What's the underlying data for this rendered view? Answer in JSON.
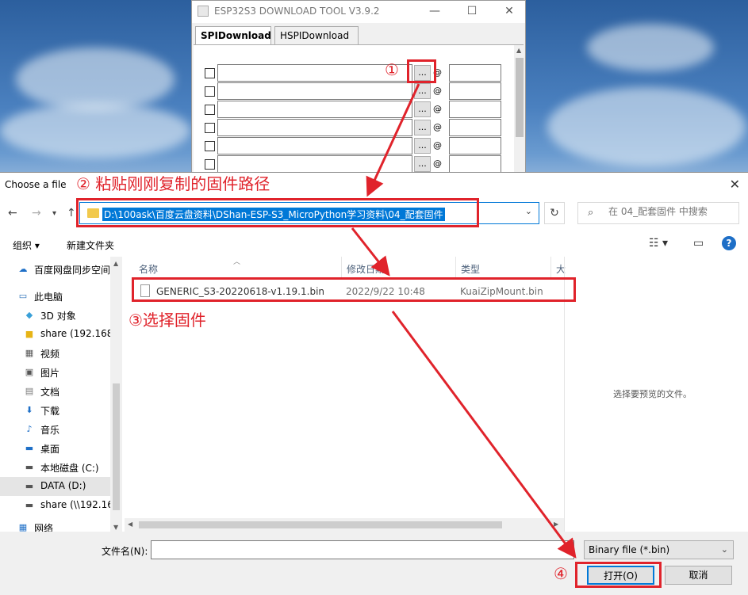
{
  "esp_tool": {
    "title": "ESP32S3 DOWNLOAD TOOL V3.9.2",
    "tabs": [
      "SPIDownload",
      "HSPIDownload"
    ],
    "browse_label": "...",
    "at_label": "@"
  },
  "dialog": {
    "title": "Choose a file",
    "address": "D:\\100ask\\百度云盘资料\\DShan-ESP-S3_MicroPython学习资料\\04_配套固件",
    "search_placeholder": "在 04_配套固件 中搜索",
    "toolbar": {
      "organize": "组织 ▾",
      "new_folder": "新建文件夹"
    },
    "sidebar": [
      {
        "label": "百度网盘同步空间",
        "icon": "cloud-icon"
      },
      {
        "label": "此电脑",
        "icon": "computer-icon"
      },
      {
        "label": "3D 对象",
        "icon": "cube-icon"
      },
      {
        "label": "share (192.168",
        "icon": "network-folder-icon"
      },
      {
        "label": "视频",
        "icon": "video-icon"
      },
      {
        "label": "图片",
        "icon": "picture-icon"
      },
      {
        "label": "文档",
        "icon": "document-icon"
      },
      {
        "label": "下载",
        "icon": "download-icon"
      },
      {
        "label": "音乐",
        "icon": "music-icon"
      },
      {
        "label": "桌面",
        "icon": "desktop-icon"
      },
      {
        "label": "本地磁盘 (C:)",
        "icon": "drive-icon"
      },
      {
        "label": "DATA (D:)",
        "icon": "drive-icon"
      },
      {
        "label": "share (\\\\192.16",
        "icon": "network-drive-icon"
      },
      {
        "label": "网络",
        "icon": "network-icon"
      }
    ],
    "columns": [
      "名称",
      "修改日期",
      "类型",
      "大"
    ],
    "files": [
      {
        "name": "GENERIC_S3-20220618-v1.19.1.bin",
        "modified": "2022/9/22 10:48",
        "type": "KuaiZipMount.bin"
      }
    ],
    "preview_message": "选择要预览的文件。",
    "filename_label": "文件名(N):",
    "filename_value": "",
    "filetype": "Binary file (*.bin)",
    "open_button": "打开(O)",
    "cancel_button": "取消"
  },
  "annotations": {
    "step1": "①",
    "step2": "② 粘贴刚刚复制的固件路径",
    "step3": "③选择固件",
    "step4": "④",
    "color": "#e0232b"
  }
}
